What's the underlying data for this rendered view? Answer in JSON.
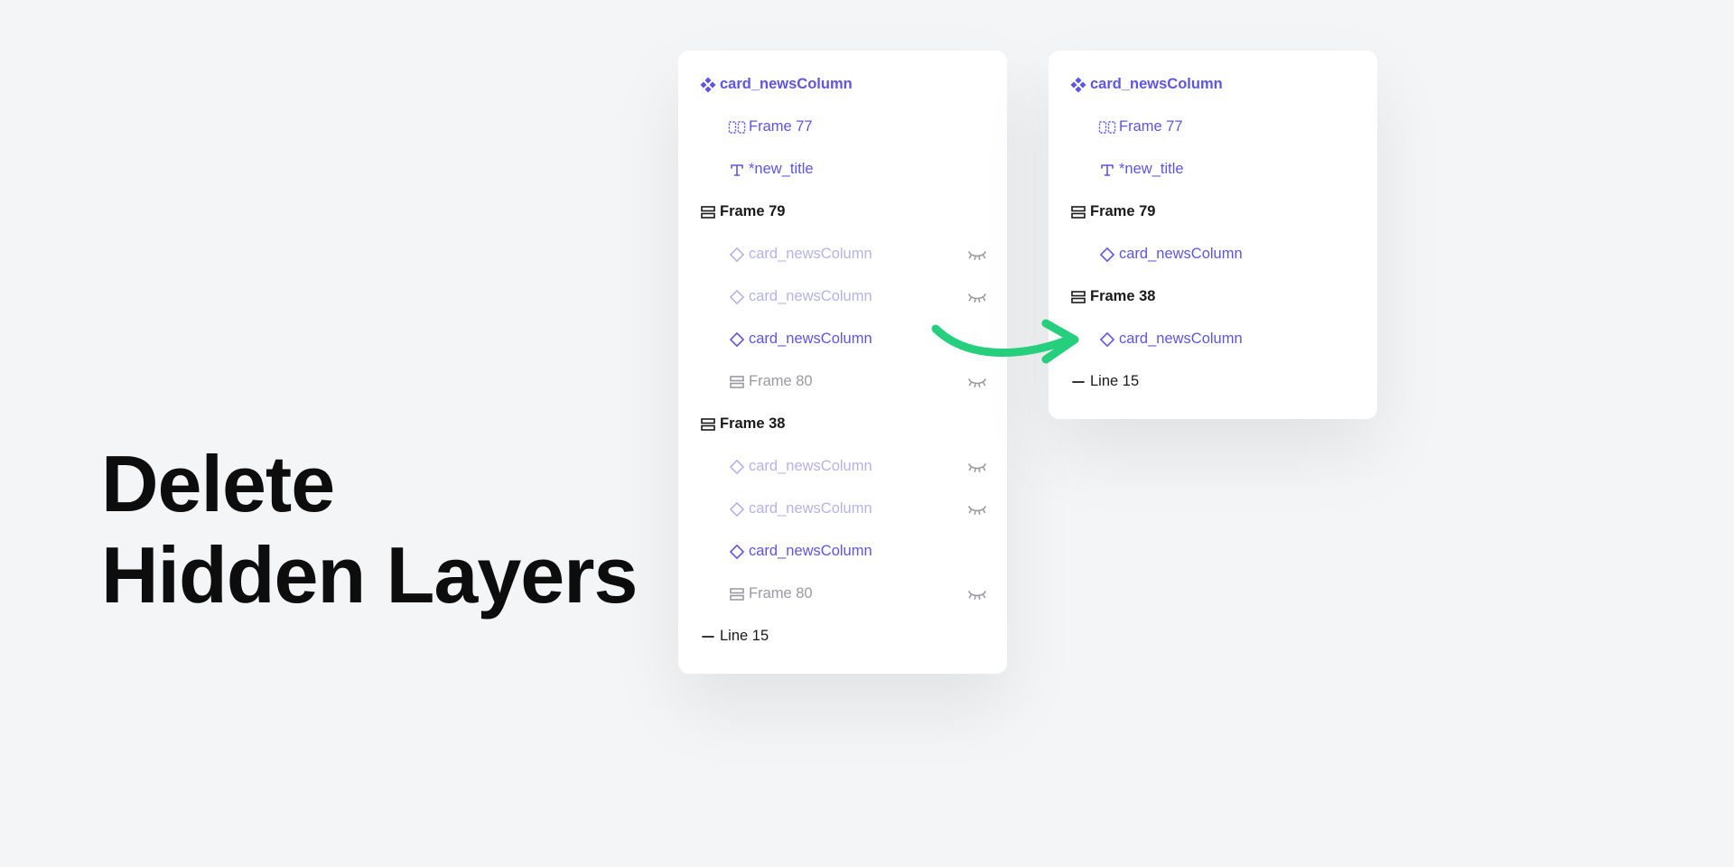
{
  "headline": {
    "line1": "Delete",
    "line2": "Hidden Layers"
  },
  "colors": {
    "purple": "#5c55e8",
    "purple_dim": "#b6b2ea",
    "black": "#1a1a1a",
    "grey": "#9a9aa2",
    "arrow": "#26cf7e"
  },
  "panels": {
    "before": [
      {
        "icon": "component",
        "label": "card_newsColumn",
        "indent": 0,
        "color": "purple",
        "bold": true,
        "hidden": false
      },
      {
        "icon": "text-group",
        "label": "Frame 77",
        "indent": 1,
        "color": "purple",
        "bold": false,
        "hidden": false
      },
      {
        "icon": "text",
        "label": "*new_title",
        "indent": 1,
        "color": "purple",
        "bold": false,
        "hidden": false
      },
      {
        "icon": "frame",
        "label": "Frame 79",
        "indent": 0,
        "color": "black",
        "bold": true,
        "hidden": false
      },
      {
        "icon": "instance",
        "label": "card_newsColumn",
        "indent": 1,
        "color": "dim",
        "bold": false,
        "hidden": true
      },
      {
        "icon": "instance",
        "label": "card_newsColumn",
        "indent": 1,
        "color": "dim",
        "bold": false,
        "hidden": true
      },
      {
        "icon": "instance",
        "label": "card_newsColumn",
        "indent": 1,
        "color": "purple",
        "bold": false,
        "hidden": false
      },
      {
        "icon": "frame",
        "label": "Frame 80",
        "indent": 1,
        "color": "grey",
        "bold": false,
        "hidden": true
      },
      {
        "icon": "frame",
        "label": "Frame 38",
        "indent": 0,
        "color": "black",
        "bold": true,
        "hidden": false
      },
      {
        "icon": "instance",
        "label": "card_newsColumn",
        "indent": 1,
        "color": "dim",
        "bold": false,
        "hidden": true
      },
      {
        "icon": "instance",
        "label": "card_newsColumn",
        "indent": 1,
        "color": "dim",
        "bold": false,
        "hidden": true
      },
      {
        "icon": "instance",
        "label": "card_newsColumn",
        "indent": 1,
        "color": "purple",
        "bold": false,
        "hidden": false
      },
      {
        "icon": "frame",
        "label": "Frame 80",
        "indent": 1,
        "color": "grey",
        "bold": false,
        "hidden": true
      },
      {
        "icon": "line",
        "label": "Line 15",
        "indent": 0,
        "color": "black",
        "bold": false,
        "hidden": false
      }
    ],
    "after": [
      {
        "icon": "component",
        "label": "card_newsColumn",
        "indent": 0,
        "color": "purple",
        "bold": true,
        "hidden": false
      },
      {
        "icon": "text-group",
        "label": "Frame 77",
        "indent": 1,
        "color": "purple",
        "bold": false,
        "hidden": false
      },
      {
        "icon": "text",
        "label": "*new_title",
        "indent": 1,
        "color": "purple",
        "bold": false,
        "hidden": false
      },
      {
        "icon": "frame",
        "label": "Frame 79",
        "indent": 0,
        "color": "black",
        "bold": true,
        "hidden": false
      },
      {
        "icon": "instance",
        "label": "card_newsColumn",
        "indent": 1,
        "color": "purple",
        "bold": false,
        "hidden": false
      },
      {
        "icon": "frame",
        "label": "Frame 38",
        "indent": 0,
        "color": "black",
        "bold": true,
        "hidden": false
      },
      {
        "icon": "instance",
        "label": "card_newsColumn",
        "indent": 1,
        "color": "purple",
        "bold": false,
        "hidden": false
      },
      {
        "icon": "line",
        "label": "Line 15",
        "indent": 0,
        "color": "black",
        "bold": false,
        "hidden": false
      }
    ]
  }
}
